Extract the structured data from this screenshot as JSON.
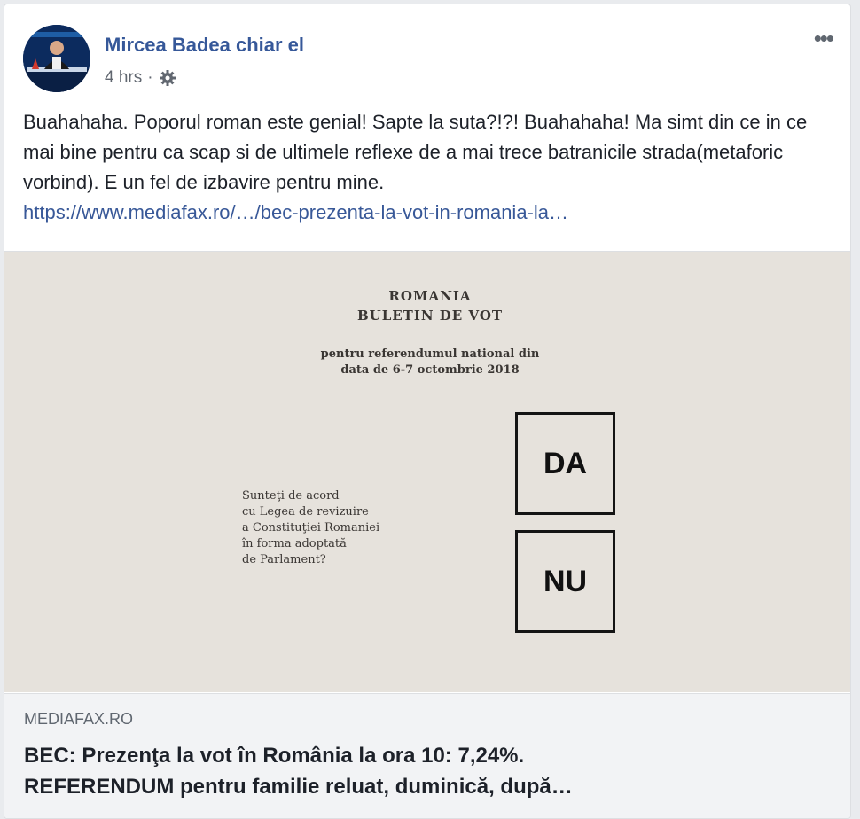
{
  "post": {
    "author": "Mircea Badea chiar el",
    "timestamp": "4 hrs",
    "separator": "·",
    "audience_icon": "gear-icon",
    "more_label": "•••",
    "text": "Buahahaha. Poporul roman este genial! Sapte la suta?!?! Buahahaha! Ma simt din ce in ce mai bine pentru ca scap si de ultimele reflexe de a mai trece batranicile strada(metaforic vorbind). E un fel de izbavire pentru mine.",
    "link_text": "https://www.mediafax.ro/…/bec-prezenta-la-vot-in-romania-la…"
  },
  "ballot": {
    "title_line1": "ROMANIA",
    "title_line2": "BULETIN DE VOT",
    "subtitle_line1": "pentru referendumul national din",
    "subtitle_line2": "data de 6-7 octombrie 2018",
    "question_lines": [
      "Sunteţi de acord",
      "cu Legea de revizuire",
      "a Constituţiei Romaniei",
      "în forma adoptată",
      "de Parlament?"
    ],
    "option_yes": "DA",
    "option_no": "NU"
  },
  "link_preview": {
    "domain": "MEDIAFAX.RO",
    "title_line1": "BEC: Prezenţa la vot în România la ora 10: 7,24%.",
    "title_line2": "REFERENDUM pentru familie reluat, duminică, după…"
  },
  "colors": {
    "author": "#365899",
    "link": "#385898",
    "ballot_bg": "#e6e2dc",
    "preview_bg": "#f2f3f5"
  }
}
